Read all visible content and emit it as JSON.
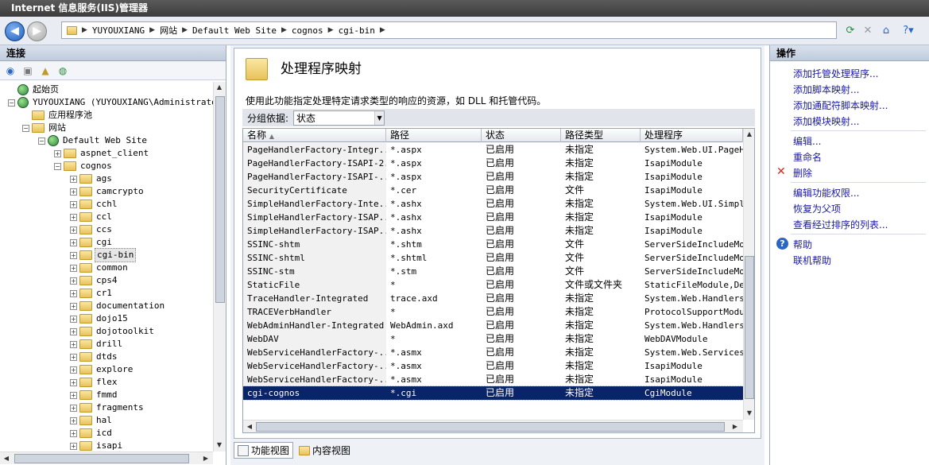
{
  "window": {
    "title": "Internet 信息服务(IIS)管理器"
  },
  "address": {
    "breadcrumbs": [
      "YUYOUXIANG",
      "网站",
      "Default Web Site",
      "cognos",
      "cgi-bin"
    ]
  },
  "connections": {
    "header": "连接",
    "tree": [
      {
        "label": "起始页",
        "level": 1,
        "icon": "start-page-icon"
      },
      {
        "label": "YUYOUXIANG (YUYOUXIANG\\Administrator)",
        "level": 1,
        "icon": "server-icon"
      },
      {
        "label": "应用程序池",
        "level": 2,
        "icon": "app-pool-icon"
      },
      {
        "label": "网站",
        "level": 2,
        "icon": "sites-folder-icon"
      },
      {
        "label": "Default Web Site",
        "level": 3,
        "icon": "globe-icon"
      },
      {
        "label": "aspnet_client",
        "level": 4,
        "icon": "folder-icon"
      },
      {
        "label": "cognos",
        "level": 4,
        "icon": "folder-icon"
      },
      {
        "label": "ags",
        "level": 5,
        "icon": "folder-icon"
      },
      {
        "label": "camcrypto",
        "level": 5,
        "icon": "folder-icon"
      },
      {
        "label": "cchl",
        "level": 5,
        "icon": "folder-icon"
      },
      {
        "label": "ccl",
        "level": 5,
        "icon": "folder-icon"
      },
      {
        "label": "ccs",
        "level": 5,
        "icon": "folder-icon"
      },
      {
        "label": "cgi",
        "level": 5,
        "icon": "folder-icon"
      },
      {
        "label": "cgi-bin",
        "level": 5,
        "icon": "folder-icon",
        "selected": true
      },
      {
        "label": "common",
        "level": 5,
        "icon": "folder-icon"
      },
      {
        "label": "cps4",
        "level": 5,
        "icon": "folder-icon"
      },
      {
        "label": "cr1",
        "level": 5,
        "icon": "folder-icon"
      },
      {
        "label": "documentation",
        "level": 5,
        "icon": "folder-icon"
      },
      {
        "label": "dojo15",
        "level": 5,
        "icon": "folder-icon"
      },
      {
        "label": "dojotoolkit",
        "level": 5,
        "icon": "folder-icon"
      },
      {
        "label": "drill",
        "level": 5,
        "icon": "folder-icon"
      },
      {
        "label": "dtds",
        "level": 5,
        "icon": "folder-icon"
      },
      {
        "label": "explore",
        "level": 5,
        "icon": "folder-icon"
      },
      {
        "label": "flex",
        "level": 5,
        "icon": "folder-icon"
      },
      {
        "label": "fmmd",
        "level": 5,
        "icon": "folder-icon"
      },
      {
        "label": "fragments",
        "level": 5,
        "icon": "folder-icon"
      },
      {
        "label": "hal",
        "level": 5,
        "icon": "folder-icon"
      },
      {
        "label": "icd",
        "level": 5,
        "icon": "folder-icon"
      },
      {
        "label": "isapi",
        "level": 5,
        "icon": "folder-icon"
      }
    ]
  },
  "feature": {
    "title": "处理程序映射",
    "description": "使用此功能指定处理特定请求类型的响应的资源，如 DLL 和托管代码。",
    "group_label": "分组依据:",
    "group_value": "状态"
  },
  "grid": {
    "columns": [
      "名称",
      "路径",
      "状态",
      "路径类型",
      "处理程序"
    ],
    "rows": [
      [
        "PageHandlerFactory-Integr...",
        "*.aspx",
        "已启用",
        "未指定",
        "System.Web.UI.PageHan"
      ],
      [
        "PageHandlerFactory-ISAPI-2.0",
        "*.aspx",
        "已启用",
        "未指定",
        "IsapiModule"
      ],
      [
        "PageHandlerFactory-ISAPI-...",
        "*.aspx",
        "已启用",
        "未指定",
        "IsapiModule"
      ],
      [
        "SecurityCertificate",
        "*.cer",
        "已启用",
        "文件",
        "IsapiModule"
      ],
      [
        "SimpleHandlerFactory-Inte...",
        "*.ashx",
        "已启用",
        "未指定",
        "System.Web.UI.SimpleH"
      ],
      [
        "SimpleHandlerFactory-ISAP...",
        "*.ashx",
        "已启用",
        "未指定",
        "IsapiModule"
      ],
      [
        "SimpleHandlerFactory-ISAP...",
        "*.ashx",
        "已启用",
        "未指定",
        "IsapiModule"
      ],
      [
        "SSINC-shtm",
        "*.shtm",
        "已启用",
        "文件",
        "ServerSideIncludeModu"
      ],
      [
        "SSINC-shtml",
        "*.shtml",
        "已启用",
        "文件",
        "ServerSideIncludeModu"
      ],
      [
        "SSINC-stm",
        "*.stm",
        "已启用",
        "文件",
        "ServerSideIncludeModu"
      ],
      [
        "StaticFile",
        "*",
        "已启用",
        "文件或文件夹",
        "StaticFileModule,Defa"
      ],
      [
        "TraceHandler-Integrated",
        "trace.axd",
        "已启用",
        "未指定",
        "System.Web.Handlers.T"
      ],
      [
        "TRACEVerbHandler",
        "*",
        "已启用",
        "未指定",
        "ProtocolSupportModule"
      ],
      [
        "WebAdminHandler-Integrated",
        "WebAdmin.axd",
        "已启用",
        "未指定",
        "System.Web.Handlers.W"
      ],
      [
        "WebDAV",
        "*",
        "已启用",
        "未指定",
        "WebDAVModule"
      ],
      [
        "WebServiceHandlerFactory-...",
        "*.asmx",
        "已启用",
        "未指定",
        "System.Web.Services.P"
      ],
      [
        "WebServiceHandlerFactory-...",
        "*.asmx",
        "已启用",
        "未指定",
        "IsapiModule"
      ],
      [
        "WebServiceHandlerFactory-...",
        "*.asmx",
        "已启用",
        "未指定",
        "IsapiModule"
      ],
      [
        "cgi-cognos",
        "*.cgi",
        "已启用",
        "未指定",
        "CgiModule"
      ]
    ],
    "selected_row": 18
  },
  "views": {
    "features_view": "功能视图",
    "content_view": "内容视图"
  },
  "actions": {
    "header": "操作",
    "add_managed_handler": "添加托管处理程序...",
    "add_script_map": "添加脚本映射...",
    "add_wildcard_script_map": "添加通配符脚本映射...",
    "add_module_mapping": "添加模块映射...",
    "edit": "编辑...",
    "rename": "重命名",
    "delete": "删除",
    "edit_feature_permissions": "编辑功能权限...",
    "revert_to_parent": "恢复为父项",
    "view_ordered_list": "查看经过排序的列表...",
    "help": "帮助",
    "online_help": "联机帮助"
  }
}
